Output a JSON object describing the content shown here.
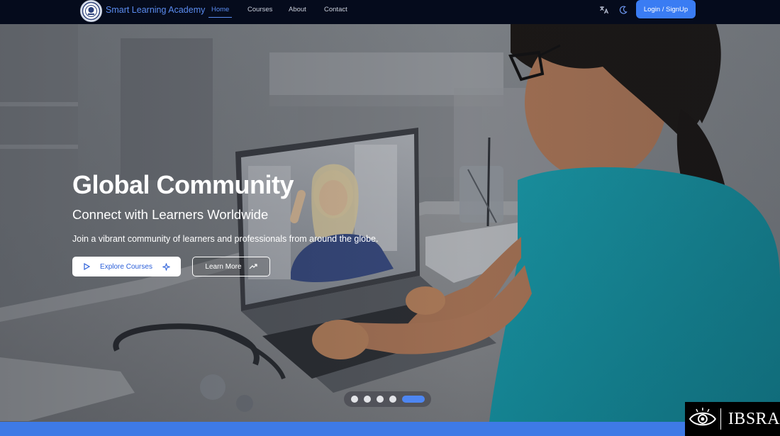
{
  "nav": {
    "brand": "Smart Learning Academy",
    "links": [
      "Home",
      "Courses",
      "About",
      "Contact"
    ],
    "active_link": "Home",
    "login_label": "Login / SignUp",
    "icons": [
      "translate-icon",
      "moon-icon"
    ]
  },
  "hero": {
    "title": "Global Community",
    "subtitle": "Connect with Learners Worldwide",
    "description": "Join a vibrant community of learners and professionals from around the globe.",
    "primary_button": "Explore Courses",
    "secondary_button": "Learn More",
    "slide_count": 5,
    "active_slide": 5
  },
  "watermark": {
    "text": "IBSRA"
  },
  "colors": {
    "accent": "#3a7cf3",
    "nav_bg": "#050b1c",
    "brand_text": "#5b8cf0"
  }
}
